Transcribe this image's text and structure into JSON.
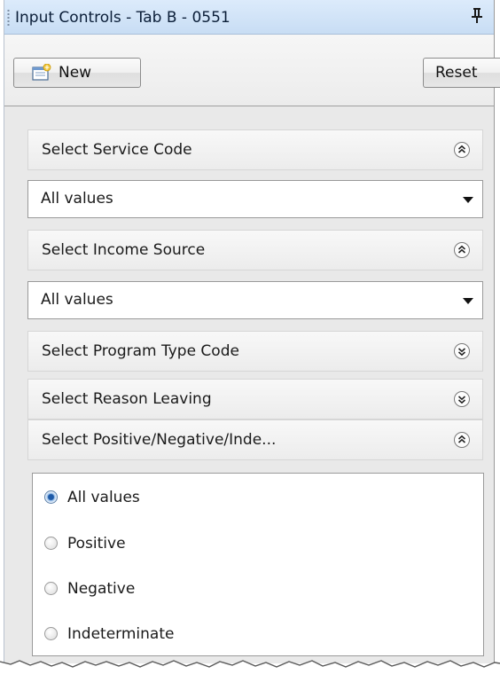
{
  "window": {
    "title": "Input Controls - Tab B - 0551"
  },
  "toolbar": {
    "new_label": "New",
    "reset_label": "Reset"
  },
  "sections": [
    {
      "label": "Select Service Code",
      "state": "expanded",
      "value": "All values"
    },
    {
      "label": "Select Income Source",
      "state": "expanded",
      "value": "All values"
    },
    {
      "label": "Select Program Type Code",
      "state": "collapsed"
    },
    {
      "label": "Select Reason Leaving",
      "state": "collapsed"
    },
    {
      "label": "Select Positive/Negative/Inde...",
      "state": "expanded"
    }
  ],
  "radio_options": [
    {
      "label": "All values",
      "checked": true
    },
    {
      "label": "Positive",
      "checked": false
    },
    {
      "label": "Negative",
      "checked": false
    },
    {
      "label": "Indeterminate",
      "checked": false
    }
  ],
  "icons": {
    "pin": "pin-icon",
    "new": "new-document-icon",
    "expanded": "collapse-chevrons-up-icon",
    "collapsed": "expand-chevrons-down-icon",
    "dropdown": "dropdown-arrow-icon"
  },
  "colors": {
    "titlebar": "#c8ddf4",
    "selected_radio": "#1d5aa8"
  }
}
